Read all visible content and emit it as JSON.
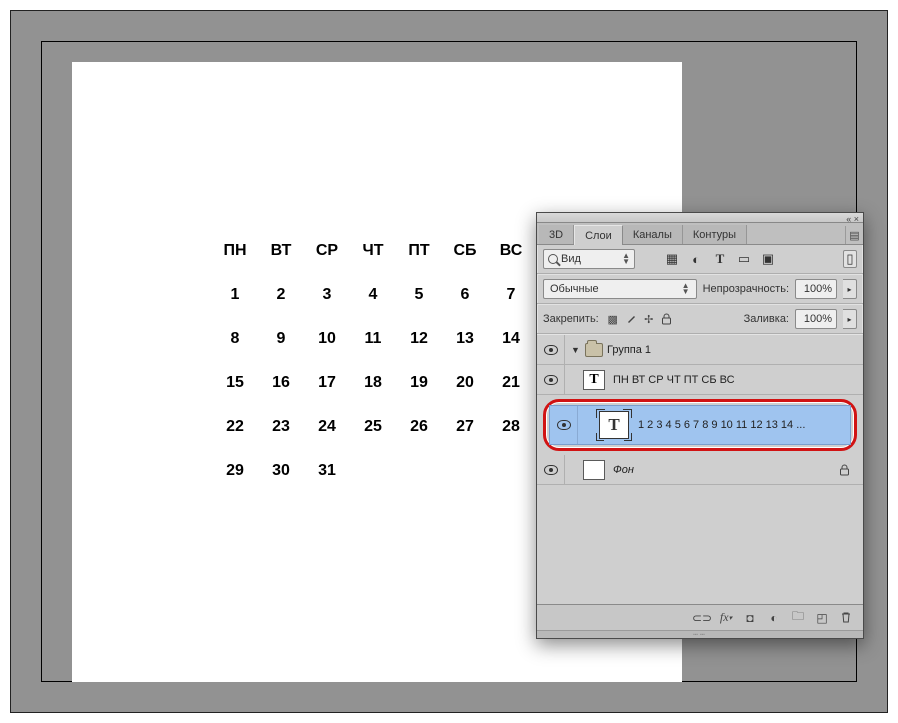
{
  "calendar": {
    "week_header": [
      "ПН",
      "ВТ",
      "СР",
      "ЧТ",
      "ПТ",
      "СБ",
      "ВС"
    ],
    "rows": [
      [
        "1",
        "2",
        "3",
        "4",
        "5",
        "6",
        "7"
      ],
      [
        "8",
        "9",
        "10",
        "11",
        "12",
        "13",
        "14"
      ],
      [
        "15",
        "16",
        "17",
        "18",
        "19",
        "20",
        "21"
      ],
      [
        "22",
        "23",
        "24",
        "25",
        "26",
        "27",
        "28"
      ],
      [
        "29",
        "30",
        "31",
        "",
        "",
        "",
        ""
      ]
    ]
  },
  "panel": {
    "tabs": {
      "t3d": "3D",
      "layers": "Слои",
      "channels": "Каналы",
      "paths": "Контуры"
    },
    "filter_label": "Вид",
    "blend_mode": "Обычные",
    "opacity_label": "Непрозрачность:",
    "opacity_value": "100%",
    "lock_label": "Закрепить:",
    "fill_label": "Заливка:",
    "fill_value": "100%",
    "layers": {
      "group1": "Группа 1",
      "weekdays": "ПН ВТ СР ЧТ ПТ СБ ВС",
      "numbers": "1  2  3  4  5  6  7  8  9 10 11 12 13 14 ...",
      "background": "Фон"
    }
  }
}
